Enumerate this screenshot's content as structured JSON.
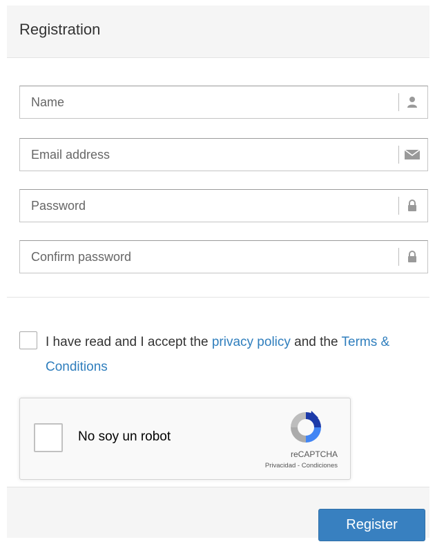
{
  "panel": {
    "title": "Registration"
  },
  "fields": {
    "name": {
      "placeholder": "Name",
      "value": "",
      "icon": "user-icon"
    },
    "email": {
      "placeholder": "Email address",
      "value": "",
      "icon": "envelope-icon"
    },
    "password": {
      "placeholder": "Password",
      "value": "",
      "icon": "lock-icon"
    },
    "confirm": {
      "placeholder": "Confirm password",
      "value": "",
      "icon": "lock-icon"
    }
  },
  "accept": {
    "prefix": "I have read and I accept the ",
    "privacy_link": "privacy policy",
    "middle": " and the ",
    "terms_link": "Terms & Conditions",
    "link_color": "#2f7ebd"
  },
  "captcha": {
    "label": "No soy un robot",
    "brand": "reCAPTCHA",
    "links": "Privacidad - Condiciones"
  },
  "footer": {
    "register_label": "Register",
    "button_color": "#3880c0"
  }
}
